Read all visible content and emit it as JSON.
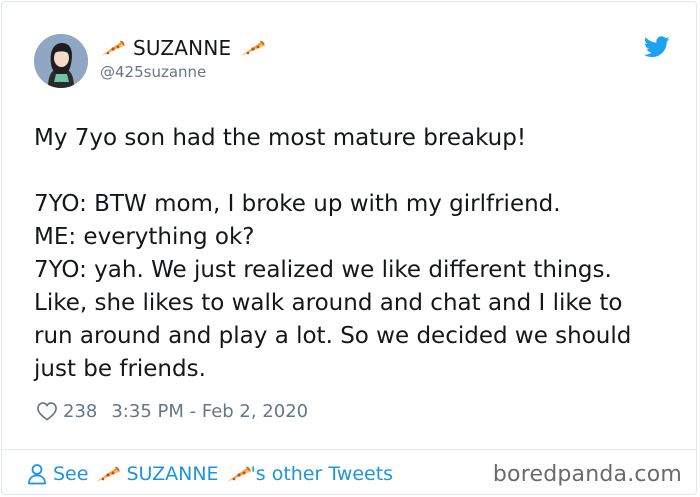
{
  "user": {
    "display_name": "SUZANNE",
    "handle": "@425suzanne",
    "avatar_icon": "avatar-illustration-woman"
  },
  "tweet": {
    "lines": [
      "My 7yo son had the most mature breakup!",
      "",
      "7YO: BTW mom, I broke up with my girlfriend.",
      "ME: everything ok?",
      "7YO: yah. We just realized we like different things.",
      "Like, she likes to walk around and chat and I like to",
      "run around and play a lot. So we decided we should",
      "just be friends."
    ],
    "likes": "238",
    "timestamp": "3:35 PM - Feb 2, 2020"
  },
  "footer": {
    "see": "See",
    "name": "SUZANNE",
    "suffix": "'s other Tweets"
  },
  "watermark": "boredpanda.com",
  "icons": {
    "brand": "twitter-bird-icon",
    "like": "heart-icon",
    "profile": "person-icon",
    "emoji": "pizza-slice-icon"
  },
  "colors": {
    "twitter_blue": "#1da1f2",
    "link_blue": "#1b95e0",
    "text": "#14171a",
    "muted": "#657786",
    "border": "#e1e8ed"
  }
}
